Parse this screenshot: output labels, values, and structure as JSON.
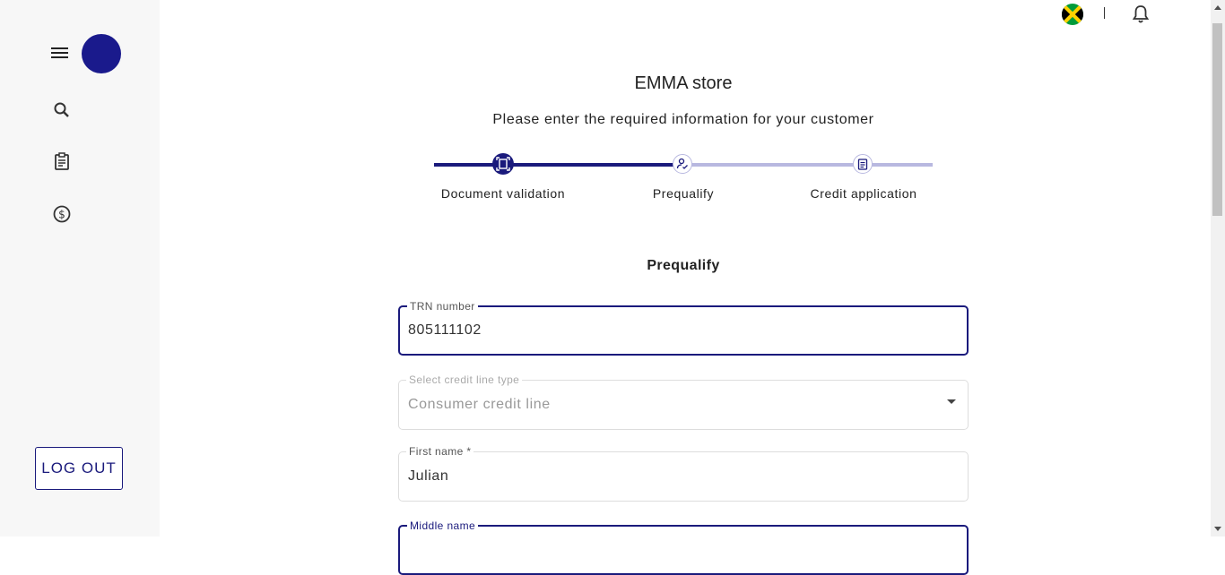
{
  "header": {
    "store_title": "EMMA store",
    "subtitle": "Please enter the required information for your customer"
  },
  "sidebar": {
    "items": [
      {
        "icon": "menu-icon"
      },
      {
        "icon": "search-icon"
      },
      {
        "icon": "clipboard-icon"
      },
      {
        "icon": "dollar-icon"
      }
    ],
    "logout_label": "LOG OUT"
  },
  "topbar": {
    "flag": "jamaica-flag-icon",
    "notifications": "bell-icon"
  },
  "stepper": {
    "steps": [
      {
        "label": "Document validation",
        "icon": "document-scan-icon",
        "state": "completed"
      },
      {
        "label": "Prequalify",
        "icon": "user-check-icon",
        "state": "active"
      },
      {
        "label": "Credit application",
        "icon": "clipboard-icon",
        "state": "pending"
      }
    ]
  },
  "form": {
    "section_title": "Prequalify",
    "trn": {
      "label": "TRN number",
      "value": "805111102"
    },
    "credit_type": {
      "label": "Select credit line type",
      "value": "Consumer credit line"
    },
    "first_name": {
      "label": "First name *",
      "value": "Julian"
    },
    "middle_name": {
      "label": "Middle name",
      "value": ""
    }
  },
  "colors": {
    "accent": "#1a1a7c",
    "avatar": "#1a1a8c",
    "step_inactive": "#b8b8e0",
    "sidebar_bg": "#f7f7f7"
  }
}
